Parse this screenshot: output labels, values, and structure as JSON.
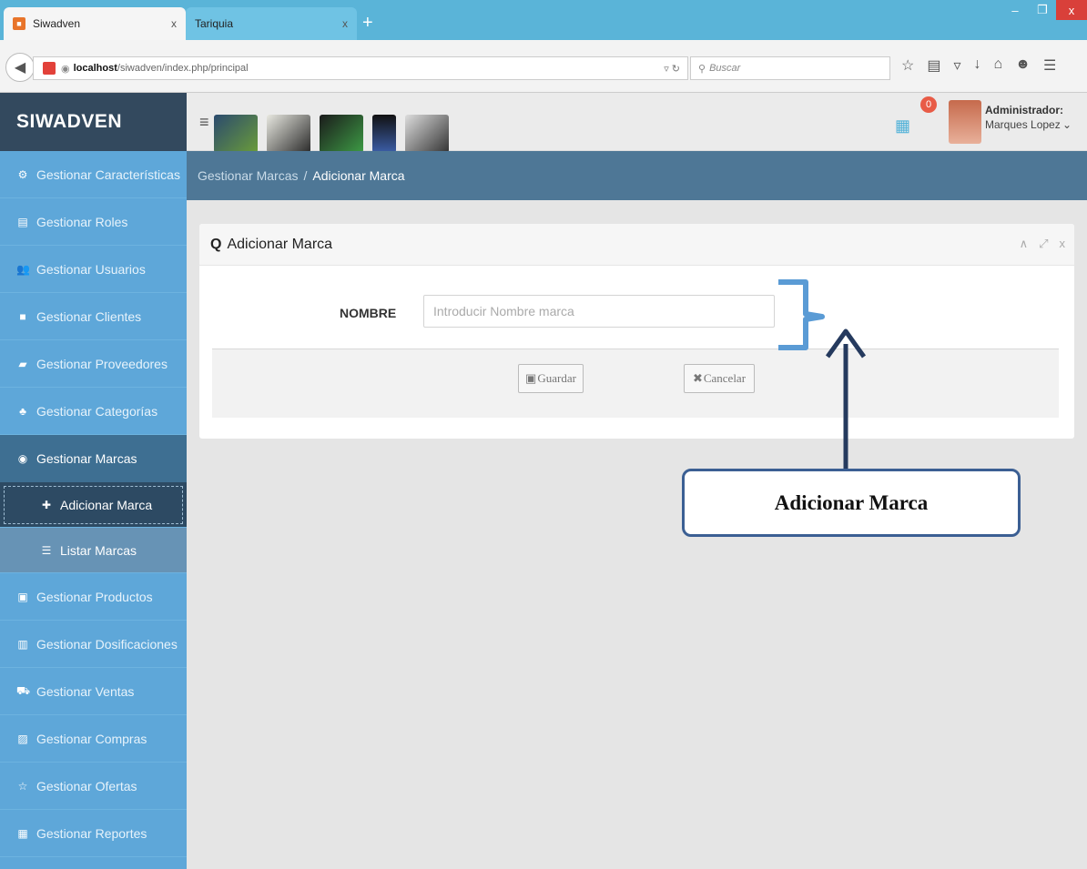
{
  "browser": {
    "tabs": [
      {
        "label": "Siwadven",
        "close": "x",
        "active": true
      },
      {
        "label": "Tariquia",
        "close": "x",
        "active": false
      }
    ],
    "newtab": "+",
    "window_controls": {
      "minimize": "–",
      "maximize": "❐",
      "close": "x"
    },
    "url_host": "localhost",
    "url_path": "/siwadven/index.php/principal",
    "search_placeholder": "Buscar"
  },
  "app": {
    "brand": "SIWADVEN",
    "notification_count": "0",
    "user_role": "Administrador:",
    "user_name": "Marques Lopez"
  },
  "sidebar": {
    "items": [
      {
        "label": "Gestionar Características",
        "icon": "cogs-icon",
        "glyph": "⚙"
      },
      {
        "label": "Gestionar Roles",
        "icon": "roles-icon",
        "glyph": "▤"
      },
      {
        "label": "Gestionar Usuarios",
        "icon": "users-icon",
        "glyph": "👥"
      },
      {
        "label": "Gestionar Clientes",
        "icon": "briefcase-icon",
        "glyph": "■"
      },
      {
        "label": "Gestionar Proveedores",
        "icon": "truck-icon",
        "glyph": "▰"
      },
      {
        "label": "Gestionar Categorías",
        "icon": "sitemap-icon",
        "glyph": "♣"
      },
      {
        "label": "Gestionar Marcas",
        "icon": "target-icon",
        "glyph": "◉"
      },
      {
        "label": "Adicionar Marca",
        "icon": "plus-icon",
        "glyph": "✚"
      },
      {
        "label": "Listar Marcas",
        "icon": "list-icon",
        "glyph": "☰"
      },
      {
        "label": "Gestionar Productos",
        "icon": "products-icon",
        "glyph": "▣"
      },
      {
        "label": "Gestionar Dosificaciones",
        "icon": "book-icon",
        "glyph": "▥"
      },
      {
        "label": "Gestionar Ventas",
        "icon": "cart-icon",
        "glyph": "⛟"
      },
      {
        "label": "Gestionar Compras",
        "icon": "receipt-icon",
        "glyph": "▨"
      },
      {
        "label": "Gestionar Ofertas",
        "icon": "star-icon",
        "glyph": "☆"
      },
      {
        "label": "Gestionar Reportes",
        "icon": "reports-icon",
        "glyph": "▦"
      }
    ]
  },
  "breadcrumb": {
    "parent": "Gestionar Marcas",
    "separator": "/",
    "current": "Adicionar Marca"
  },
  "form": {
    "title": "Adicionar Marca",
    "field_label": "NOMBRE",
    "field_placeholder": "Introducir Nombre marca",
    "field_value": "",
    "save_label": "Guardar",
    "cancel_label": "Cancelar"
  },
  "annotation": {
    "label": "Adicionar Marca"
  },
  "colors": {
    "sidebar": "#5ea7d9",
    "sidebar_active": "#3e6f92",
    "brand_bar": "#33495e",
    "breadcrumb_bar": "#4e7796",
    "annotation": "#3b5f93"
  }
}
